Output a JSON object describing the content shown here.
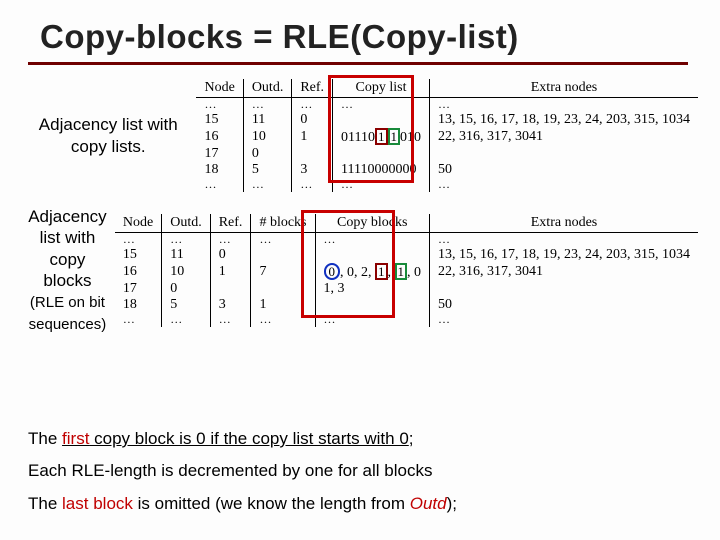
{
  "title": "Copy-blocks = RLE(Copy-list)",
  "block1": {
    "caption1": "Adjacency list with",
    "caption2": "copy lists.",
    "headers": {
      "node": "Node",
      "outd": "Outd.",
      "ref": "Ref.",
      "copy": "Copy list",
      "extra": "Extra nodes"
    },
    "rows": [
      {
        "node": "…",
        "outd": "…",
        "ref": "…",
        "copy": "…",
        "extra": "…"
      },
      {
        "node": "15",
        "outd": "11",
        "ref": "0",
        "copy": "",
        "extra": "13, 15, 16, 17, 18, 19, 23, 24, 203, 315, 1034"
      },
      {
        "node": "16",
        "outd": "10",
        "ref": "1",
        "copy_pre": "01110",
        "copy_r": "1",
        "copy_g": "1",
        "copy_post": "010",
        "extra": "22, 316, 317, 3041"
      },
      {
        "node": "17",
        "outd": "0",
        "ref": "",
        "copy": "",
        "extra": ""
      },
      {
        "node": "18",
        "outd": "5",
        "ref": "3",
        "copy": "11110000000",
        "extra": "50"
      },
      {
        "node": "…",
        "outd": "…",
        "ref": "…",
        "copy": "…",
        "extra": "…"
      }
    ]
  },
  "block2": {
    "caption1": "Adjacency list with",
    "caption2": "copy blocks",
    "caption3": "(RLE on bit sequences)",
    "headers": {
      "node": "Node",
      "outd": "Outd.",
      "ref": "Ref.",
      "nb": "# blocks",
      "cb": "Copy blocks",
      "extra": "Extra nodes"
    },
    "rows": [
      {
        "node": "…",
        "outd": "…",
        "ref": "…",
        "nb": "…",
        "cb": "…",
        "extra": "…"
      },
      {
        "node": "15",
        "outd": "11",
        "ref": "0",
        "nb": "",
        "cb": "",
        "extra": "13, 15, 16, 17, 18, 19, 23, 24, 203, 315, 1034"
      },
      {
        "node": "16",
        "outd": "10",
        "ref": "1",
        "nb": "7",
        "cb_o": "0",
        "cb_mid": ", 0, 2, ",
        "cb_r": "1",
        "cb_g": "1",
        "cb_post": ", 0",
        "extra": "22, 316, 317, 3041"
      },
      {
        "node": "17",
        "outd": "0",
        "ref": "",
        "nb": "",
        "cb": "1, 3",
        "extra": ""
      },
      {
        "node": "18",
        "outd": "5",
        "ref": "3",
        "nb": "1",
        "cb": "",
        "extra": "50"
      },
      {
        "node": "…",
        "outd": "…",
        "ref": "…",
        "nb": "…",
        "cb": "…",
        "extra": "…"
      }
    ]
  },
  "notes": {
    "l1a": "The ",
    "l1b": "first",
    "l1c": " copy block is 0 if the copy list starts with 0",
    "l2": "Each RLE-length is decremented by one for all blocks",
    "l3a": "The ",
    "l3b": "last block",
    "l3c": " is omitted (we know the length from ",
    "l3d": "Outd",
    "l3e": ");"
  }
}
